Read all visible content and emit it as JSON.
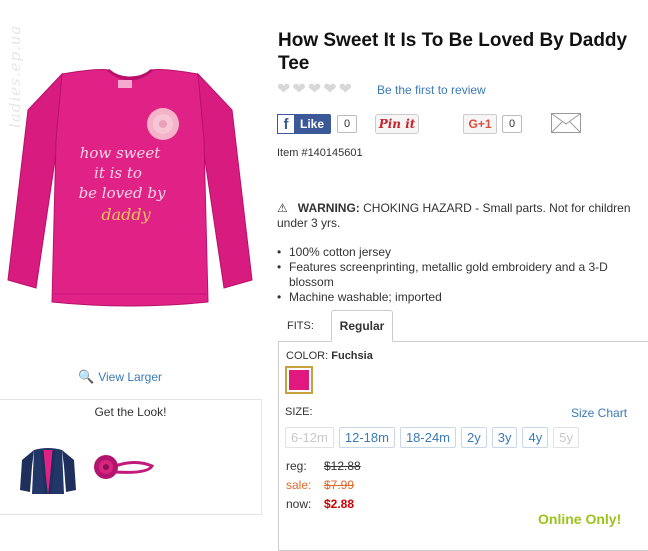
{
  "watermark": "ladies.ep.ua",
  "product": {
    "title": "How Sweet It Is To Be Loved By Daddy Tee",
    "review_link": "Be the first to review",
    "item_number": "Item #140145601",
    "shirt_text": [
      "how sweet",
      "it is to",
      "be loved by",
      "daddy"
    ]
  },
  "social": {
    "like_label": "Like",
    "like_count": "0",
    "pinit_label": "Pin it",
    "gplus_label": "G+1",
    "gplus_count": "0"
  },
  "warning": {
    "label": "WARNING:",
    "text": "CHOKING HAZARD - Small parts. Not for children under 3 yrs."
  },
  "features": [
    "100% cotton jersey",
    "Features screenprinting, metallic gold embroidery and a 3-D blossom",
    "Machine washable; imported"
  ],
  "left": {
    "view_larger": "View Larger",
    "get_the_look": "Get the Look!"
  },
  "fits": {
    "label": "FITS:",
    "active_tab": "Regular"
  },
  "color": {
    "label": "COLOR:",
    "value": "Fuchsia",
    "swatch_hex": "#e2187f"
  },
  "size": {
    "label": "SIZE:",
    "chart_link": "Size Chart",
    "options": [
      {
        "label": "6-12m",
        "available": false
      },
      {
        "label": "12-18m",
        "available": true
      },
      {
        "label": "18-24m",
        "available": true
      },
      {
        "label": "2y",
        "available": true
      },
      {
        "label": "3y",
        "available": true
      },
      {
        "label": "4y",
        "available": true
      },
      {
        "label": "5y",
        "available": false
      }
    ]
  },
  "pricing": {
    "reg_label": "reg:",
    "reg_value": "$12.88",
    "sale_label": "sale:",
    "sale_value": "$7.99",
    "now_label": "now:",
    "now_value": "$2.88",
    "online_only": "Online Only!"
  },
  "colors": {
    "accent_link": "#3b7ab8",
    "now_price": "#cc0000",
    "sale_price": "#e06a2a",
    "online_only": "#9cc31c",
    "facebook": "#3b5998"
  }
}
